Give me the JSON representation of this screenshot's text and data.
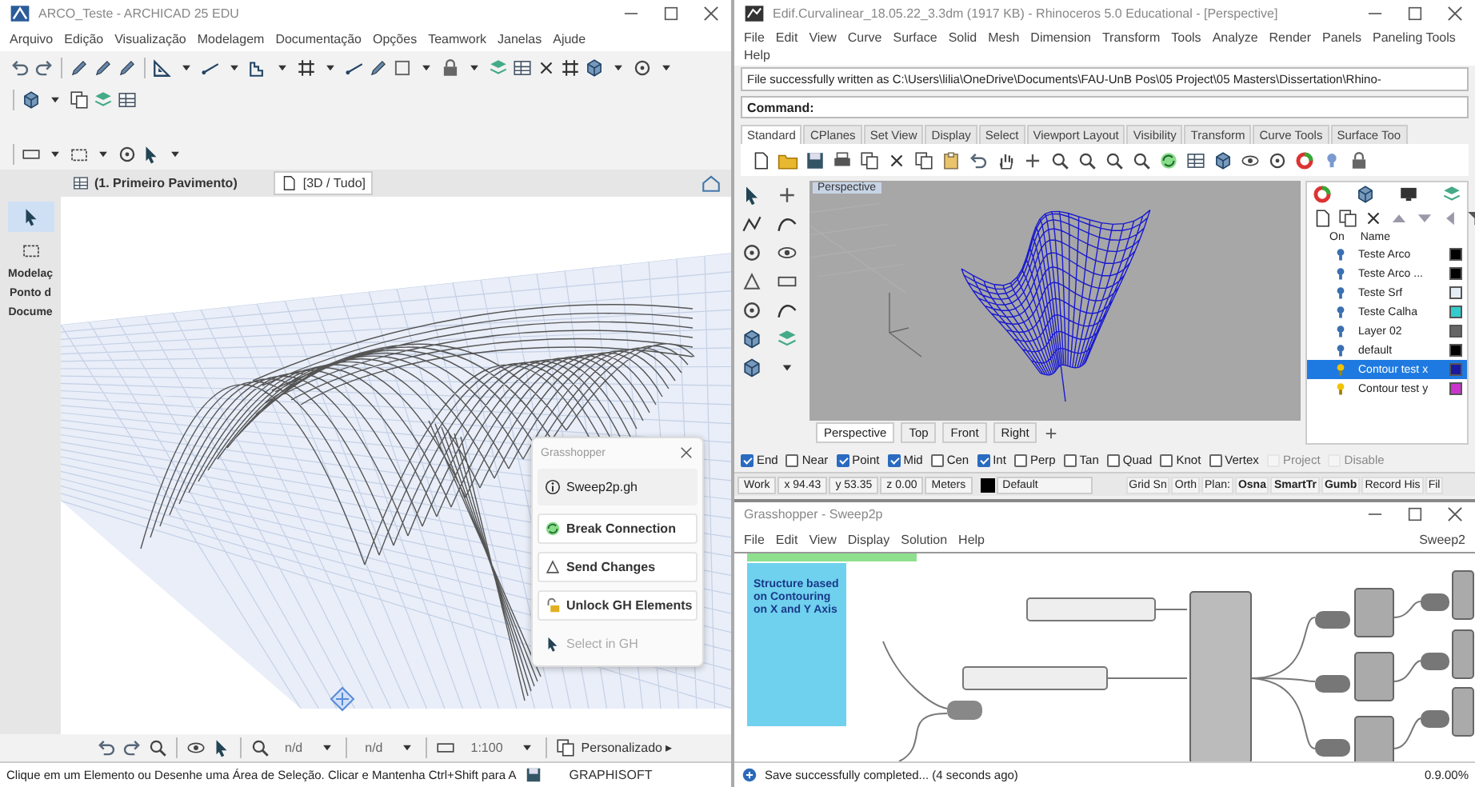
{
  "archicad": {
    "title": "ARCO_Teste - ARCHICAD 25 EDU",
    "menu": [
      "Arquivo",
      "Edição",
      "Visualização",
      "Modelagem",
      "Documentação",
      "Opções",
      "Teamwork",
      "Janelas",
      "Ajude"
    ],
    "view_tabs": [
      {
        "label": "(1. Primeiro Pavimento)",
        "selected": false
      },
      {
        "label": "[3D / Tudo]",
        "selected": true
      }
    ],
    "palette": [
      "Modelaç",
      "Ponto d",
      "Docume"
    ],
    "grasshopper_popup": {
      "title": "Grasshopper",
      "file": "Sweep2p.gh",
      "actions": [
        {
          "label": "Break Connection",
          "disabled": false
        },
        {
          "label": "Send Changes",
          "disabled": false
        },
        {
          "label": "Unlock GH Elements",
          "disabled": false
        },
        {
          "label": "Select in GH",
          "disabled": true
        }
      ]
    },
    "nav_bar": {
      "field_1": "n/d",
      "field_2": "n/d",
      "scale": "1:100",
      "view": "Personalizado ▸"
    },
    "status_bar": {
      "message": "Clique em um Elemento ou Desenhe uma Área de Seleção. Clicar e Mantenha Ctrl+Shift para A",
      "brand": "GRAPHISOFT"
    }
  },
  "rhino": {
    "title": "Edif.Curvalinear_18.05.22_3.3dm (1917 KB) - Rhinoceros 5.0 Educational - [Perspective]",
    "menu": [
      "File",
      "Edit",
      "View",
      "Curve",
      "Surface",
      "Solid",
      "Mesh",
      "Dimension",
      "Transform",
      "Tools",
      "Analyze",
      "Render",
      "Panels",
      "Paneling Tools",
      "Help"
    ],
    "history": "File successfully written as C:\\Users\\lilia\\OneDrive\\Documents\\FAU-UnB Pos\\05 Project\\05 Masters\\Dissertation\\Rhino-",
    "command_prompt": "Command:",
    "toolbar_tabs": [
      {
        "label": "Standard",
        "selected": true
      },
      {
        "label": "CPlanes",
        "selected": false
      },
      {
        "label": "Set View",
        "selected": false
      },
      {
        "label": "Display",
        "selected": false
      },
      {
        "label": "Select",
        "selected": false
      },
      {
        "label": "Viewport Layout",
        "selected": false
      },
      {
        "label": "Visibility",
        "selected": false
      },
      {
        "label": "Transform",
        "selected": false
      },
      {
        "label": "Curve Tools",
        "selected": false
      },
      {
        "label": "Surface Too",
        "selected": false
      }
    ],
    "viewport": {
      "label": "Perspective"
    },
    "viewport_tabs": [
      {
        "label": "Perspective",
        "selected": true
      },
      {
        "label": "Top",
        "selected": false
      },
      {
        "label": "Front",
        "selected": false
      },
      {
        "label": "Right",
        "selected": false
      }
    ],
    "layers": {
      "columns": [
        "On",
        "Name"
      ],
      "rows": [
        {
          "name": "Teste Arco",
          "on": false,
          "color": "#000000",
          "selected": false
        },
        {
          "name": "Teste Arco ...",
          "on": false,
          "color": "#000000",
          "selected": false
        },
        {
          "name": "Teste Srf",
          "on": false,
          "color": "#e6eef5",
          "selected": false
        },
        {
          "name": "Teste Calha",
          "on": false,
          "color": "#33cccc",
          "selected": false
        },
        {
          "name": "Layer 02",
          "on": false,
          "color": "#666666",
          "selected": false
        },
        {
          "name": "default",
          "on": false,
          "color": "#000000",
          "selected": false
        },
        {
          "name": "Contour test x",
          "on": true,
          "color": "#1a1aa0",
          "selected": true
        },
        {
          "name": "Contour test y",
          "on": true,
          "color": "#cc33cc",
          "selected": false
        }
      ]
    },
    "osnaps": [
      {
        "label": "End",
        "checked": true,
        "disabled": false
      },
      {
        "label": "Near",
        "checked": false,
        "disabled": false
      },
      {
        "label": "Point",
        "checked": true,
        "disabled": false
      },
      {
        "label": "Mid",
        "checked": true,
        "disabled": false
      },
      {
        "label": "Cen",
        "checked": false,
        "disabled": false
      },
      {
        "label": "Int",
        "checked": true,
        "disabled": false
      },
      {
        "label": "Perp",
        "checked": false,
        "disabled": false
      },
      {
        "label": "Tan",
        "checked": false,
        "disabled": false
      },
      {
        "label": "Quad",
        "checked": false,
        "disabled": false
      },
      {
        "label": "Knot",
        "checked": false,
        "disabled": false
      },
      {
        "label": "Vertex",
        "checked": false,
        "disabled": false
      },
      {
        "label": "Project",
        "checked": false,
        "disabled": true
      },
      {
        "label": "Disable",
        "checked": false,
        "disabled": true
      }
    ],
    "status_bar": {
      "cplane": "Work",
      "x": "x 94.43",
      "y": "y 53.35",
      "z": "z 0.00",
      "units": "Meters",
      "layer": "Default",
      "toggles": [
        {
          "label": "Grid Sn",
          "on": false
        },
        {
          "label": "Orth",
          "on": false
        },
        {
          "label": "Plan:",
          "on": false
        },
        {
          "label": "Osna",
          "on": true
        },
        {
          "label": "SmartTr",
          "on": true
        },
        {
          "label": "Gumb",
          "on": true
        },
        {
          "label": "Record His",
          "on": false
        },
        {
          "label": "Fil",
          "on": false
        }
      ]
    }
  },
  "grasshopper": {
    "title": "Grasshopper - Sweep2p",
    "menu": [
      "File",
      "Edit",
      "View",
      "Display",
      "Solution",
      "Help"
    ],
    "document_tab": "Sweep2",
    "group_label": "Structure based on Contouring on X and Y Axis",
    "status": "Save successfully completed... (4 seconds ago)",
    "zoom": "0.9.00%"
  }
}
